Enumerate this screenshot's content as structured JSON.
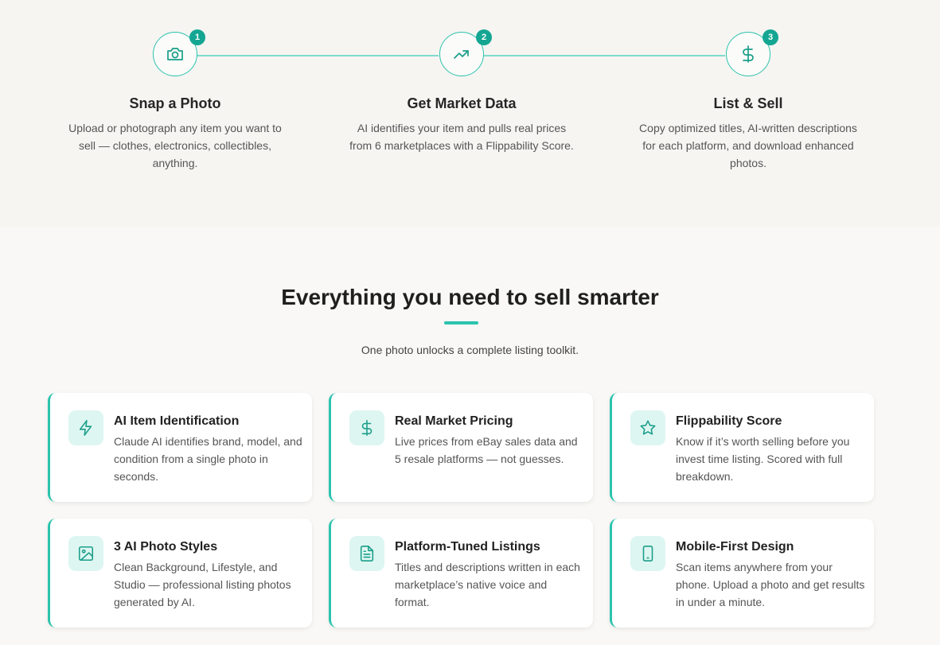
{
  "steps": [
    {
      "number": "1",
      "icon": "camera-icon",
      "title": "Snap a Photo",
      "desc": "Upload or photograph any item you want to sell — clothes, electronics, collectibles, anything."
    },
    {
      "number": "2",
      "icon": "trending-up-icon",
      "title": "Get Market Data",
      "desc": "AI identifies your item and pulls real prices from 6 marketplaces with a Flippability Score."
    },
    {
      "number": "3",
      "icon": "dollar-icon",
      "title": "List & Sell",
      "desc": "Copy optimized titles, AI-written descriptions for each platform, and download enhanced photos."
    }
  ],
  "features_section": {
    "title": "Everything you need to sell smarter",
    "subtitle": "One photo unlocks a complete listing toolkit.",
    "cards": [
      {
        "icon": "lightning-icon",
        "title": "AI Item Identification",
        "desc": "Claude AI identifies brand, model, and condition from a single photo in seconds."
      },
      {
        "icon": "dollar-icon",
        "title": "Real Market Pricing",
        "desc": "Live prices from eBay sales data and 5 resale platforms — not guesses."
      },
      {
        "icon": "star-icon",
        "title": "Flippability Score",
        "desc": "Know if it’s worth selling before you invest time listing. Scored with full breakdown."
      },
      {
        "icon": "image-icon",
        "title": "3 AI Photo Styles",
        "desc": "Clean Background, Lifestyle, and Studio — professional listing photos generated by AI."
      },
      {
        "icon": "document-icon",
        "title": "Platform-Tuned Listings",
        "desc": "Titles and descriptions written in each marketplace’s native voice and format."
      },
      {
        "icon": "phone-icon",
        "title": "Mobile-First Design",
        "desc": "Scan items anywhere from your phone. Upload a photo and get results in under a minute."
      }
    ]
  },
  "colors": {
    "accent": "#2cc3ad",
    "badge": "#14a692",
    "icon_bg": "#ddf6f1"
  }
}
